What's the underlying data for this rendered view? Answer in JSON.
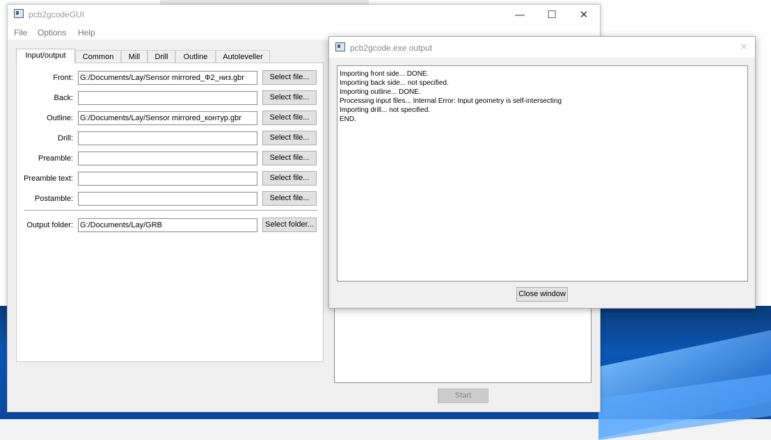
{
  "main_window": {
    "title": "pcb2gcodeGUI",
    "controls": {
      "minimize": "—",
      "maximize": "☐",
      "close": "✕"
    },
    "menu": [
      "File",
      "Options",
      "Help"
    ],
    "tabs": [
      "Input/output",
      "Common",
      "Mill",
      "Drill",
      "Outline",
      "Autoleveller"
    ],
    "active_tab": "Input/output",
    "rows": [
      {
        "label": "Front:",
        "value": "G:/Documents/Lay/Sensor mirrored_Ф2_низ.gbr",
        "button": "Select file..."
      },
      {
        "label": "Back:",
        "value": "",
        "button": "Select file..."
      },
      {
        "label": "Outline:",
        "value": "G:/Documents/Lay/Sensor mirrored_контур.gbr",
        "button": "Select file..."
      },
      {
        "label": "Drill:",
        "value": "",
        "button": "Select file..."
      },
      {
        "label": "Preamble:",
        "value": "",
        "button": "Select file..."
      },
      {
        "label": "Preamble text:",
        "value": "",
        "button": "Select file..."
      },
      {
        "label": "Postamble:",
        "value": "",
        "button": "Select file..."
      }
    ],
    "output_folder": {
      "label": "Output folder:",
      "value": "G:/Documents/Lay/GRB",
      "button": "Select folder..."
    },
    "start_button": "Start"
  },
  "output_window": {
    "title": "pcb2gcode.exe output",
    "close_glyph": "✕",
    "lines": [
      "Importing front side... DONE.",
      "Importing back side... not specified.",
      "Importing outline... DONE.",
      "Processing input files... Internal Error: Input geometry is self-intersecting",
      "Importing drill... not specified.",
      "END."
    ],
    "close_button": "Close window"
  }
}
